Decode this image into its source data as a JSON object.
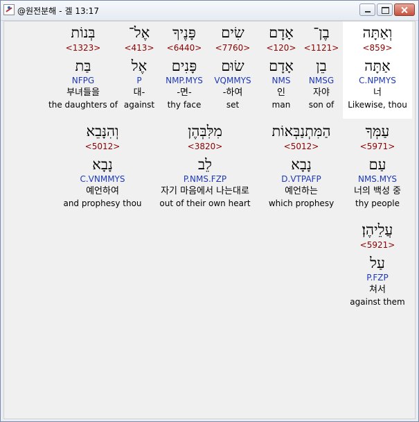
{
  "window": {
    "title": "@원전분해",
    "location": "겔 13:17"
  },
  "rows": [
    [
      {
        "hebrew": "וְאַתָּה",
        "strong": "<859>",
        "lexeme": "אַתָּה",
        "morph": "C.NPMYS",
        "korean": "너",
        "english": "Likewise, thou"
      },
      {
        "hebrew": "בֶן־",
        "strong": "<1121>",
        "lexeme": "בֵן",
        "morph": "NMSG",
        "korean": "자야",
        "english": "son of"
      },
      {
        "hebrew": "אָדָם",
        "strong": "<120>",
        "lexeme": "אָדָם",
        "morph": "NMS",
        "korean": "인",
        "english": "man"
      },
      {
        "hebrew": "שִׂים",
        "strong": "<7760>",
        "lexeme": "שׂוּם",
        "morph": "VQMMYS",
        "korean": "-하여",
        "english": "set"
      },
      {
        "hebrew": "פָּנֶיךָ",
        "strong": "<6440>",
        "lexeme": "פָּנִים",
        "morph": "NMP.MYS",
        "korean": "-면-",
        "english": "thy face"
      },
      {
        "hebrew": "אֶל־",
        "strong": "<413>",
        "lexeme": "אֶל",
        "morph": "P",
        "korean": "대-",
        "english": "against"
      },
      {
        "hebrew": "בְּנוֹת",
        "strong": "<1323>",
        "lexeme": "בַּת",
        "morph": "NFPG",
        "korean": "부녀들을",
        "english": "the daughters of"
      }
    ],
    [
      {
        "hebrew": "עַמְּךָ",
        "strong": "<5971>",
        "lexeme": "עַם",
        "morph": "NMS.MYS",
        "korean": "너의 백성 중",
        "english": "thy people"
      },
      {
        "hebrew": "הַמִּתְנַבְּאוֹת",
        "strong": "<5012>",
        "lexeme": "נָבָא",
        "morph": "D.VTPAFP",
        "korean": "예언하는",
        "english": "which prophesy"
      },
      {
        "hebrew": "מִלִּבְּהֶן",
        "strong": "<3820>",
        "lexeme": "לֵב",
        "morph": "P.NMS.FZP",
        "korean": "자기 마음에서 나는대로",
        "english": "out of their own heart"
      },
      {
        "hebrew": "וְהִנָּבֵא",
        "strong": "<5012>",
        "lexeme": "נָבָא",
        "morph": "C.VNMMYS",
        "korean": "예언하여",
        "english": "and prophesy thou"
      }
    ],
    [
      {
        "hebrew": "עֲלֵיהֶן׃",
        "strong": "<5921>",
        "lexeme": "עַל",
        "morph": "P.FZP",
        "korean": "쳐서",
        "english": "against them"
      }
    ]
  ],
  "colors": {
    "strong": "#8b0000",
    "morph": "#1c38b8",
    "active_bg": "#ffffff"
  }
}
